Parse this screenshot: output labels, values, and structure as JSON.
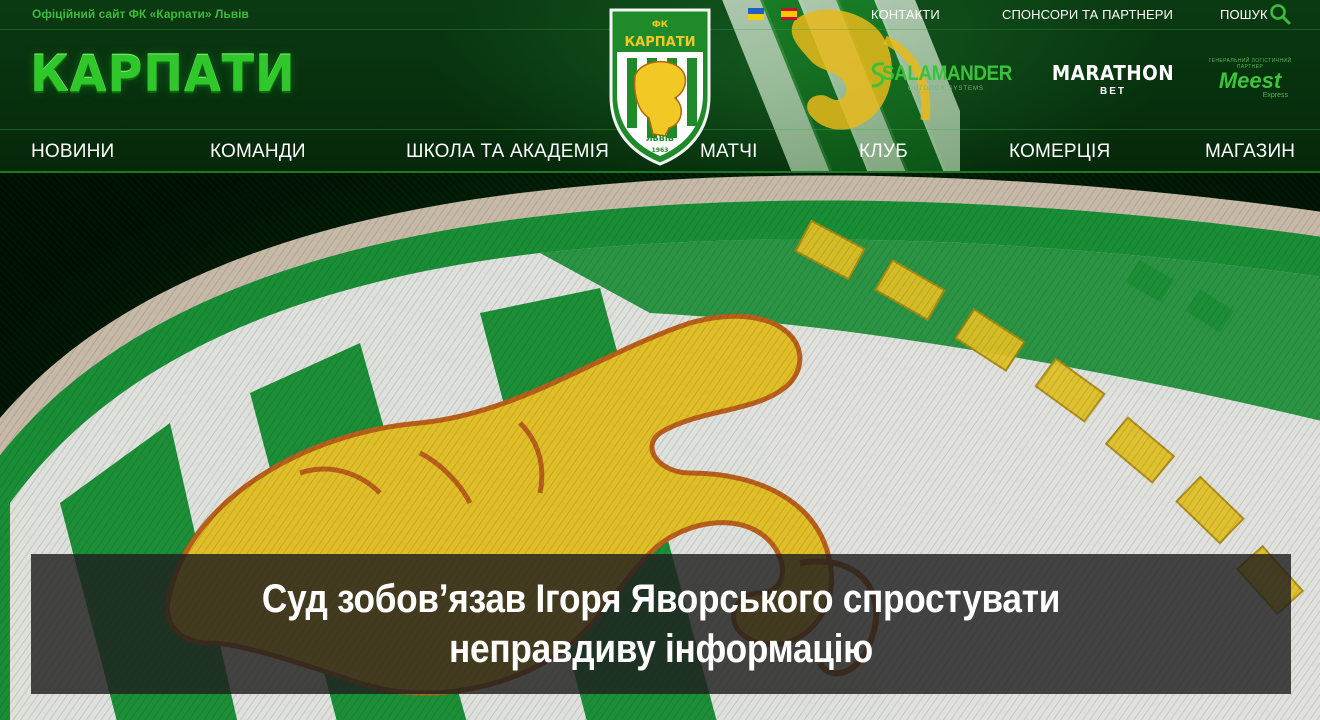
{
  "topbar": {
    "tagline": "Офіційний сайт ФК «Карпати» Львів",
    "languages": [
      {
        "code": "uk",
        "icon": "ukraine-flag-icon"
      },
      {
        "code": "es",
        "icon": "spain-flag-icon"
      }
    ],
    "links": {
      "contacts": "КОНТАКТИ",
      "sponsors": "СПОНСОРИ ТА ПАРТНЕРИ",
      "search": "ПОШУК"
    },
    "search_icon": "magnifier-icon"
  },
  "brand": {
    "logo_text": "КАРПАТИ",
    "crest": {
      "top": "ФК",
      "name": "КАРПАТИ",
      "city": "ЛЬВІВ",
      "year": "1963"
    }
  },
  "sponsors": {
    "salamander": {
      "name": "SALAMANDER",
      "sub": "OUTDOOR SYSTEMS"
    },
    "marathon": {
      "name": "MARATHON",
      "sub": "BET"
    },
    "meest": {
      "tiny": "ГЕНЕРАЛЬНИЙ ЛОГІСТИЧНИЙ ПАРТНЕР",
      "name": "Meest",
      "sub": "Express"
    }
  },
  "nav": {
    "items": [
      {
        "label": "НОВИНИ"
      },
      {
        "label": "КОМАНДИ"
      },
      {
        "label": "ШКОЛА ТА АКАДЕМІЯ"
      },
      {
        "label": "МАТЧІ"
      },
      {
        "label": "КЛУБ"
      },
      {
        "label": "КОМЕРЦІЯ"
      },
      {
        "label": "МАГАЗИН"
      }
    ]
  },
  "hero": {
    "headline": "Суд зобов’язав Ігоря Яворського спростувати неправдиву інформацію"
  },
  "colors": {
    "brand_green": "#2fc72a",
    "header_bg": "#05280a",
    "headline_bg": "#1e1e1e",
    "lion_yellow": "#f2c824"
  }
}
